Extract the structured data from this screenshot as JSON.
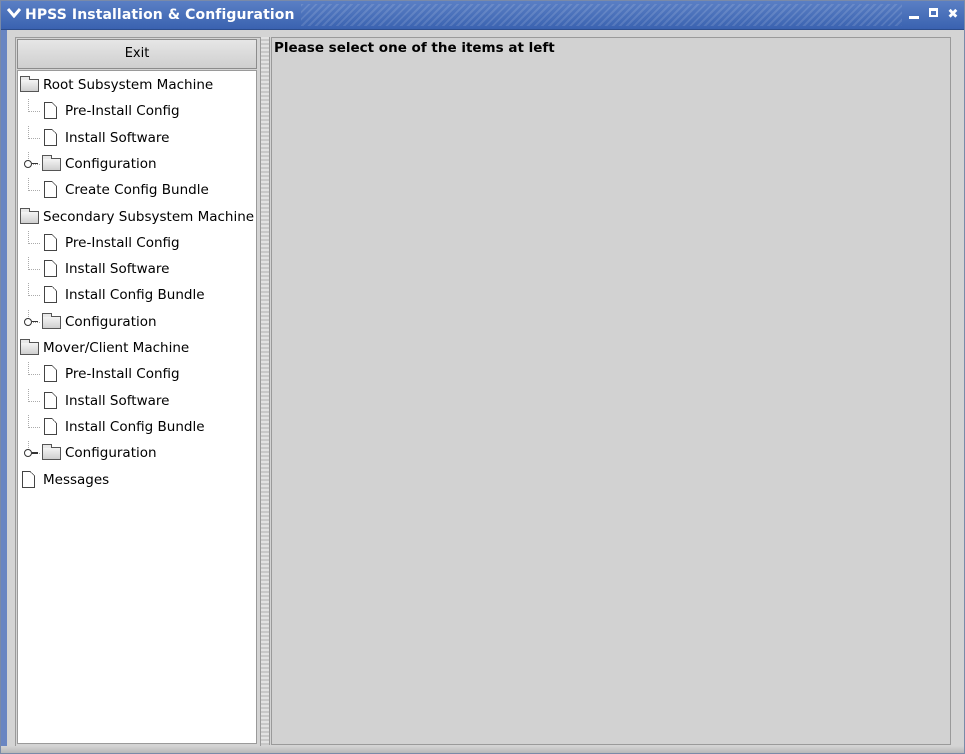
{
  "window": {
    "title": "HPSS Installation & Configuration",
    "menu_glyph": "∨",
    "close_glyph": "✖"
  },
  "sidebar": {
    "exit_label": "Exit",
    "tree": [
      {
        "label": "Root Subsystem Machine",
        "type": "folder",
        "level": 0
      },
      {
        "label": "Pre-Install Config",
        "type": "doc",
        "level": 1
      },
      {
        "label": "Install Software",
        "type": "doc",
        "level": 1
      },
      {
        "label": "Configuration",
        "type": "folder-collapsed",
        "level": 1
      },
      {
        "label": "Create Config Bundle",
        "type": "doc",
        "level": 1
      },
      {
        "label": "Secondary Subsystem Machine",
        "type": "folder",
        "level": 0
      },
      {
        "label": "Pre-Install Config",
        "type": "doc",
        "level": 1
      },
      {
        "label": "Install Software",
        "type": "doc",
        "level": 1
      },
      {
        "label": "Install Config Bundle",
        "type": "doc",
        "level": 1
      },
      {
        "label": "Configuration",
        "type": "folder-collapsed",
        "level": 1
      },
      {
        "label": "Mover/Client Machine",
        "type": "folder",
        "level": 0
      },
      {
        "label": "Pre-Install Config",
        "type": "doc",
        "level": 1
      },
      {
        "label": "Install Software",
        "type": "doc",
        "level": 1
      },
      {
        "label": "Install Config Bundle",
        "type": "doc",
        "level": 1
      },
      {
        "label": "Configuration",
        "type": "folder-collapsed",
        "level": 1
      },
      {
        "label": "Messages",
        "type": "doc",
        "level": 0
      }
    ]
  },
  "main": {
    "message": "Please select one of the items at left"
  },
  "colors": {
    "titlebar": "#3a62b0",
    "panel_bg": "#d2d2d2",
    "tree_bg": "#ffffff"
  }
}
